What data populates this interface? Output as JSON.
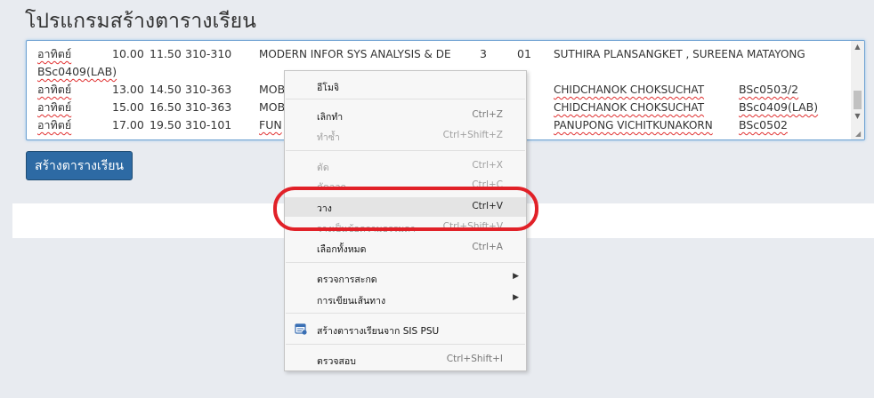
{
  "page": {
    "title": "โปรแกรมสร้างตารางเรียน"
  },
  "schedule": {
    "rows": [
      {
        "day": "อาทิตย์",
        "start": "10.00",
        "end": "11.50",
        "room": "310-310",
        "course": "MODERN INFOR SYS ANALYSIS & DE",
        "credit": "3",
        "section": "01",
        "instructor": "SUTHIRA PLANSANGKET , SUREENA MATAYONG"
      },
      {
        "wrap": "BSc0409(LAB)"
      },
      {
        "day": "อาทิตย์",
        "start": "13.00",
        "end": "14.50",
        "room": "310-363",
        "course": "MOB",
        "instructor": "CHIDCHANOK CHOKSUCHAT",
        "group": "BSc0503/2"
      },
      {
        "day": "อาทิตย์",
        "start": "15.00",
        "end": "16.50",
        "room": "310-363",
        "course": "MOB",
        "instructor": "CHIDCHANOK CHOKSUCHAT",
        "group": "BSc0409(LAB)"
      },
      {
        "day": "อาทิตย์",
        "start": "17.00",
        "end": "19.50",
        "room": "310-101",
        "course": "FUN",
        "instructor": "PANUPONG VICHITKUNAKORN",
        "group": "BSc0502"
      }
    ]
  },
  "buttons": {
    "create_schedule": "สร้างตารางเรียน"
  },
  "context_menu": {
    "emoji": "อีโมจิ",
    "undo": {
      "label": "เลิกทำ",
      "shortcut": "Ctrl+Z"
    },
    "redo": {
      "label": "ทำซ้ำ",
      "shortcut": "Ctrl+Shift+Z"
    },
    "cut": {
      "label": "ตัด",
      "shortcut": "Ctrl+X"
    },
    "copy": {
      "label": "คัดลอก",
      "shortcut": "Ctrl+C"
    },
    "paste": {
      "label": "วาง",
      "shortcut": "Ctrl+V"
    },
    "paste_plain": {
      "label": "วางเป็นข้อความธรรมดา",
      "shortcut": "Ctrl+Shift+V"
    },
    "select_all": {
      "label": "เลือกทั้งหมด",
      "shortcut": "Ctrl+A"
    },
    "spellcheck": "ตรวจการสะกด",
    "writing_direction": "การเขียนเส้นทาง",
    "sis_extension": "สร้างตารางเรียนจาก SIS PSU",
    "inspect": {
      "label": "ตรวจสอบ",
      "shortcut": "Ctrl+Shift+I"
    }
  },
  "colors": {
    "button": "#2d6aa4",
    "highlight": "#e12128",
    "focus_border": "#6ea1d2"
  },
  "icons": {
    "submenu": "chevron-right-icon",
    "extension": "calendar-extension-icon"
  }
}
